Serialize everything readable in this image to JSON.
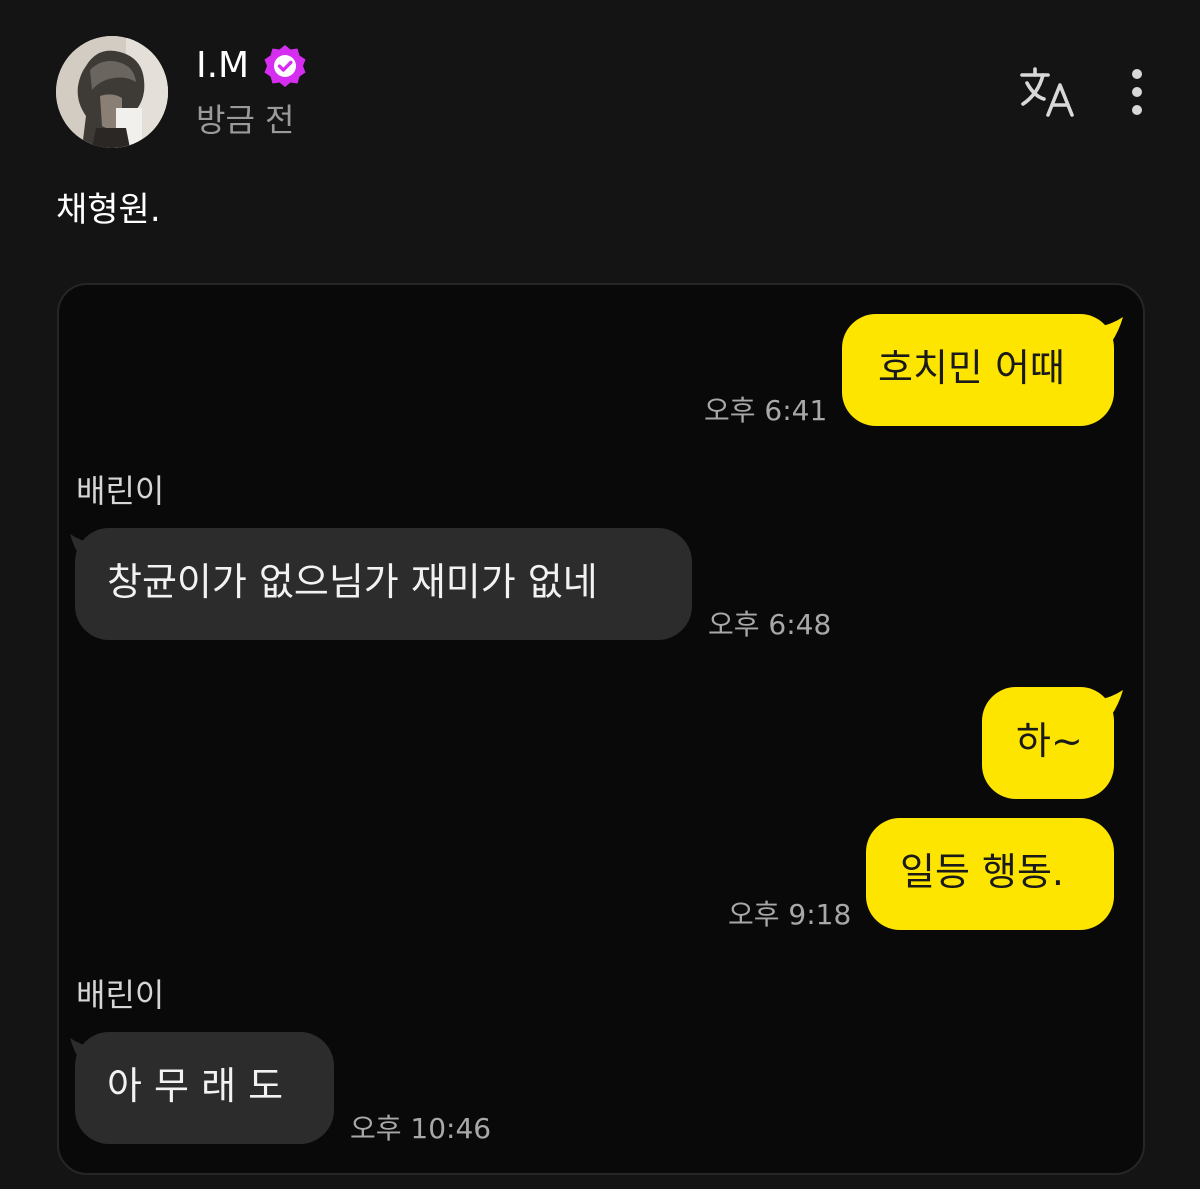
{
  "post": {
    "author": "I.M",
    "verified_icon": "verified-badge-icon",
    "time": "방금 전",
    "caption": "채형원.",
    "actions": {
      "translate_icon": "translate-icon",
      "more_icon": "more-vertical-icon"
    }
  },
  "chat": {
    "messages": [
      {
        "direction": "outgoing",
        "text": "호치민 어때",
        "time": "오후 6:41"
      },
      {
        "direction": "incoming",
        "sender": "배린이",
        "text": "창균이가 없으님가 재미가 없네",
        "time": "오후 6:48"
      },
      {
        "direction": "outgoing",
        "text": "하~"
      },
      {
        "direction": "outgoing",
        "text": "일등 행동.",
        "time": "오후 9:18"
      },
      {
        "direction": "incoming",
        "sender": "배린이",
        "text": "아 무 래 도",
        "time": "오후 10:46"
      }
    ]
  },
  "colors": {
    "background": "#141414",
    "chat_background": "#0a090a",
    "outgoing_bubble": "#fee500",
    "incoming_bubble": "#2c2c2c",
    "verified": "#d62ef0"
  }
}
